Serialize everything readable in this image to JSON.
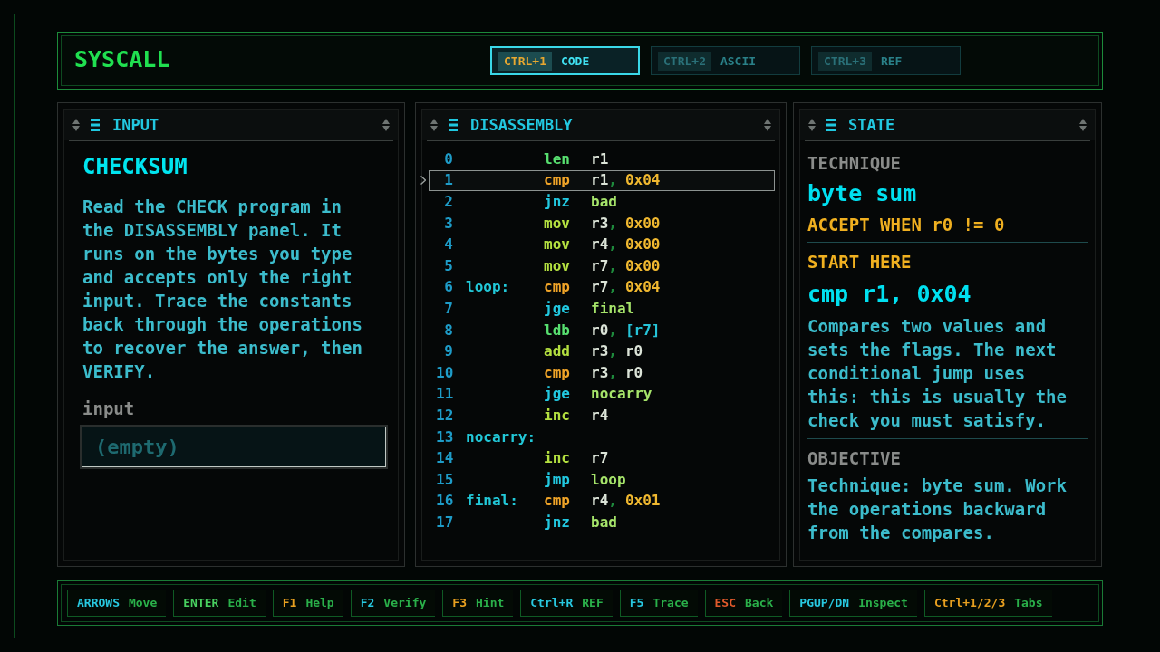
{
  "header": {
    "title": "SYSCALL",
    "tabs": [
      {
        "key": "CTRL+1",
        "label": "CODE",
        "selected": true
      },
      {
        "key": "CTRL+2",
        "label": "ASCII",
        "selected": false
      },
      {
        "key": "CTRL+3",
        "label": "REF",
        "selected": false
      }
    ]
  },
  "input_panel": {
    "title": "INPUT",
    "heading": "CHECKSUM",
    "description": "Read the CHECK program in the DISASSEMBLY panel. It runs on the bytes you type and accepts only the right input. Trace the constants back through the operations to recover the answer, then VERIFY.",
    "field": {
      "label": "input",
      "placeholder": "(empty)"
    }
  },
  "disassembly_panel": {
    "title": "DISASSEMBLY",
    "lines": [
      {
        "number": "0",
        "selected": false,
        "op": {
          "text": "len",
          "kind": "load"
        },
        "args": [
          {
            "kind": "reg",
            "text": "r1"
          }
        ]
      },
      {
        "number": "1",
        "selected": true,
        "op": {
          "text": "cmp",
          "kind": "compare"
        },
        "args": [
          {
            "kind": "reg",
            "text": "r1"
          },
          {
            "kind": "punct",
            "text": ","
          },
          {
            "kind": "imm",
            "text": "0x04"
          }
        ]
      },
      {
        "number": "2",
        "selected": false,
        "op": {
          "text": "jnz",
          "kind": "branch"
        },
        "args": [
          {
            "kind": "target",
            "text": "bad"
          }
        ]
      },
      {
        "number": "3",
        "selected": false,
        "op": {
          "text": "mov",
          "kind": "arith"
        },
        "args": [
          {
            "kind": "reg",
            "text": "r3"
          },
          {
            "kind": "punct",
            "text": ","
          },
          {
            "kind": "imm",
            "text": "0x00"
          }
        ]
      },
      {
        "number": "4",
        "selected": false,
        "op": {
          "text": "mov",
          "kind": "arith"
        },
        "args": [
          {
            "kind": "reg",
            "text": "r4"
          },
          {
            "kind": "punct",
            "text": ","
          },
          {
            "kind": "imm",
            "text": "0x00"
          }
        ]
      },
      {
        "number": "5",
        "selected": false,
        "op": {
          "text": "mov",
          "kind": "arith"
        },
        "args": [
          {
            "kind": "reg",
            "text": "r7"
          },
          {
            "kind": "punct",
            "text": ","
          },
          {
            "kind": "imm",
            "text": "0x00"
          }
        ]
      },
      {
        "number": "6",
        "selected": false,
        "label": "loop:",
        "op": {
          "text": "cmp",
          "kind": "compare"
        },
        "args": [
          {
            "kind": "reg",
            "text": "r7"
          },
          {
            "kind": "punct",
            "text": ","
          },
          {
            "kind": "imm",
            "text": "0x04"
          }
        ]
      },
      {
        "number": "7",
        "selected": false,
        "op": {
          "text": "jge",
          "kind": "branch"
        },
        "args": [
          {
            "kind": "target",
            "text": "final"
          }
        ]
      },
      {
        "number": "8",
        "selected": false,
        "op": {
          "text": "ldb",
          "kind": "load"
        },
        "args": [
          {
            "kind": "reg",
            "text": "r0"
          },
          {
            "kind": "punct",
            "text": ","
          },
          {
            "kind": "mem",
            "text": "[r7]"
          }
        ]
      },
      {
        "number": "9",
        "selected": false,
        "op": {
          "text": "add",
          "kind": "arith"
        },
        "args": [
          {
            "kind": "reg",
            "text": "r3"
          },
          {
            "kind": "punct",
            "text": ","
          },
          {
            "kind": "reg",
            "text": "r0"
          }
        ]
      },
      {
        "number": "10",
        "selected": false,
        "op": {
          "text": "cmp",
          "kind": "compare"
        },
        "args": [
          {
            "kind": "reg",
            "text": "r3"
          },
          {
            "kind": "punct",
            "text": ","
          },
          {
            "kind": "reg",
            "text": "r0"
          }
        ]
      },
      {
        "number": "11",
        "selected": false,
        "op": {
          "text": "jge",
          "kind": "branch"
        },
        "args": [
          {
            "kind": "target",
            "text": "nocarry"
          }
        ]
      },
      {
        "number": "12",
        "selected": false,
        "op": {
          "text": "inc",
          "kind": "arith"
        },
        "args": [
          {
            "kind": "reg",
            "text": "r4"
          }
        ]
      },
      {
        "number": "13",
        "selected": false,
        "label": "nocarry:"
      },
      {
        "number": "14",
        "selected": false,
        "op": {
          "text": "inc",
          "kind": "arith"
        },
        "args": [
          {
            "kind": "reg",
            "text": "r7"
          }
        ]
      },
      {
        "number": "15",
        "selected": false,
        "op": {
          "text": "jmp",
          "kind": "branch"
        },
        "args": [
          {
            "kind": "target",
            "text": "loop"
          }
        ]
      },
      {
        "number": "16",
        "selected": false,
        "label": "final:",
        "op": {
          "text": "cmp",
          "kind": "compare"
        },
        "args": [
          {
            "kind": "reg",
            "text": "r4"
          },
          {
            "kind": "punct",
            "text": ","
          },
          {
            "kind": "imm",
            "text": "0x01"
          }
        ]
      },
      {
        "number": "17",
        "selected": false,
        "op": {
          "text": "jnz",
          "kind": "branch"
        },
        "args": [
          {
            "kind": "target",
            "text": "bad"
          }
        ]
      }
    ]
  },
  "state_panel": {
    "title": "STATE",
    "technique_label": "TECHNIQUE",
    "technique": "byte sum",
    "accept": "ACCEPT WHEN r0 != 0",
    "start_label": "START HERE",
    "start_instruction": "cmp r1, 0x04",
    "start_description": "Compares two values and sets the flags. The next conditional jump uses this: this is usually the check you must satisfy.",
    "objective_label": "OBJECTIVE",
    "objective": "Technique: byte sum. Work the operations backward from the compares."
  },
  "footer": {
    "hints": [
      {
        "key": "ARROWS",
        "action": "Move",
        "color": "#28c8e0"
      },
      {
        "key": "ENTER",
        "action": "Edit",
        "color": "#48d060"
      },
      {
        "key": "F1",
        "action": "Help",
        "color": "#e8a020"
      },
      {
        "key": "F2",
        "action": "Verify",
        "color": "#28c8e0"
      },
      {
        "key": "F3",
        "action": "Hint",
        "color": "#e8a020"
      },
      {
        "key": "Ctrl+R",
        "action": "REF",
        "color": "#28c8e0"
      },
      {
        "key": "F5",
        "action": "Trace",
        "color": "#28c8e0"
      },
      {
        "key": "ESC",
        "action": "Back",
        "color": "#e05a2c"
      },
      {
        "key": "PGUP/DN",
        "action": "Inspect",
        "color": "#28c8e0"
      },
      {
        "key": "Ctrl+1/2/3",
        "action": "Tabs",
        "color": "#e8a020"
      }
    ]
  }
}
